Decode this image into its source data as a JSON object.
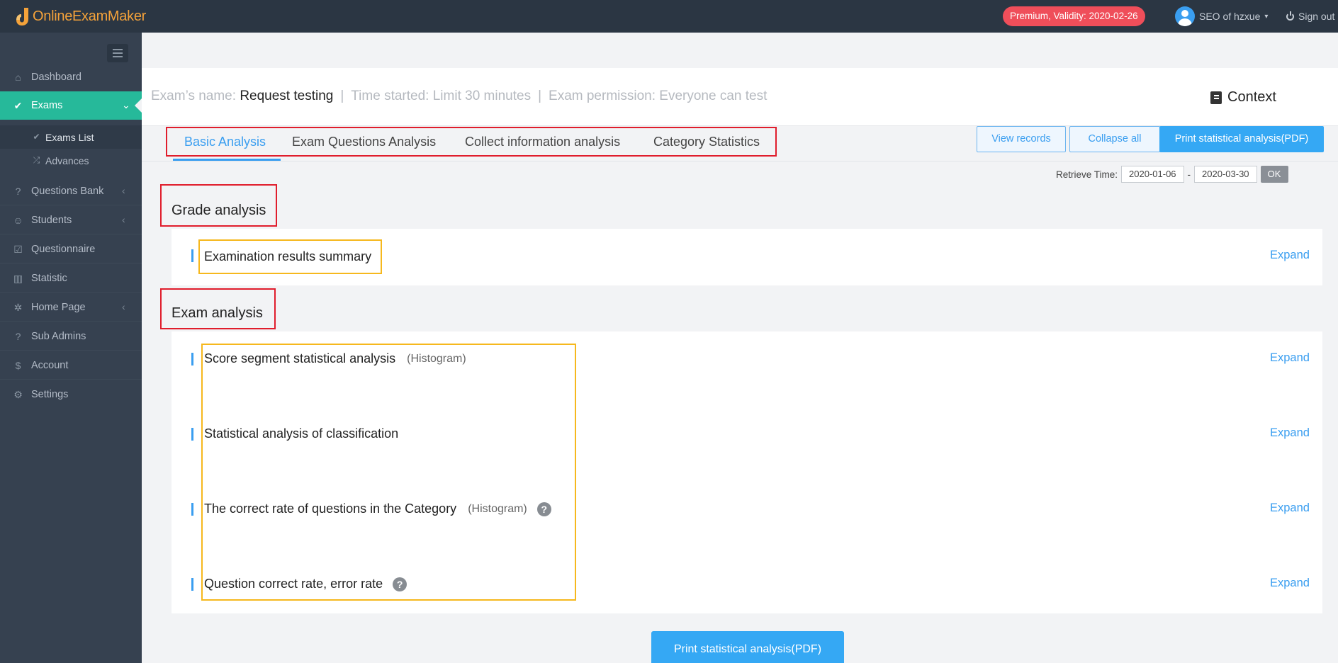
{
  "app": {
    "name": "OnlineExamMaker"
  },
  "topbar": {
    "premium_badge": "Premium, Validity: 2020-02-26",
    "user_name": "SEO of hzxue",
    "sign_out": "Sign out"
  },
  "sidebar": {
    "items": [
      {
        "label": "Dashboard",
        "icon": "home-icon"
      },
      {
        "label": "Exams",
        "icon": "check-circle-icon",
        "active": true
      },
      {
        "label": "Questions Bank",
        "icon": "question-circle-icon"
      },
      {
        "label": "Students",
        "icon": "users-icon"
      },
      {
        "label": "Questionnaire",
        "icon": "checkbox-icon"
      },
      {
        "label": "Statistic",
        "icon": "bar-chart-icon"
      },
      {
        "label": "Home Page",
        "icon": "home-page-icon"
      },
      {
        "label": "Sub Admins",
        "icon": "question-circle-icon"
      },
      {
        "label": "Account",
        "icon": "dollar-icon"
      },
      {
        "label": "Settings",
        "icon": "gear-icon"
      }
    ],
    "sub_items": [
      {
        "label": "Exams List",
        "icon": "check-circle-icon",
        "active": true
      },
      {
        "label": "Advances",
        "icon": "shuffle-icon"
      }
    ]
  },
  "exam": {
    "name_label": "Exam’s name:",
    "name_value": "Request testing",
    "time_label": "Time started:",
    "time_value": "Limit 30 minutes",
    "permission_label": "Exam permission:",
    "permission_value": "Everyone can test",
    "context_label": "Context"
  },
  "tabs": [
    {
      "label": "Basic Analysis",
      "active": true
    },
    {
      "label": "Exam Questions Analysis"
    },
    {
      "label": "Collect information analysis"
    },
    {
      "label": "Category Statistics"
    }
  ],
  "actions": {
    "view_records": "View records",
    "collapse_all": "Collapse all",
    "print_pdf": "Print statistical analysis(PDF)"
  },
  "retrieve": {
    "label": "Retrieve Time:",
    "start": "2020-01-06",
    "separator": "-",
    "end": "2020-03-30",
    "ok": "OK"
  },
  "grade_analysis": {
    "title": "Grade analysis",
    "rows": [
      {
        "label": "Examination results summary",
        "action": "Expand"
      }
    ]
  },
  "exam_analysis": {
    "title": "Exam analysis",
    "rows": [
      {
        "label": "Score segment statistical analysis",
        "note": "(Histogram)",
        "action": "Expand"
      },
      {
        "label": "Statistical analysis of classification",
        "action": "Expand"
      },
      {
        "label": "The correct rate of questions in the Category",
        "note": "(Histogram)",
        "help": "?",
        "action": "Expand"
      },
      {
        "label": "Question correct rate, error rate",
        "help": "?",
        "action": "Expand"
      }
    ]
  },
  "bottom": {
    "print_pdf": "Print statistical analysis(PDF)"
  },
  "colors": {
    "accent": "#3a9ef0",
    "sidebar_active": "#26b99a",
    "premium": "#ef4e5a",
    "annotation_red": "#e01d2c",
    "annotation_yellow": "#f6b81d"
  }
}
